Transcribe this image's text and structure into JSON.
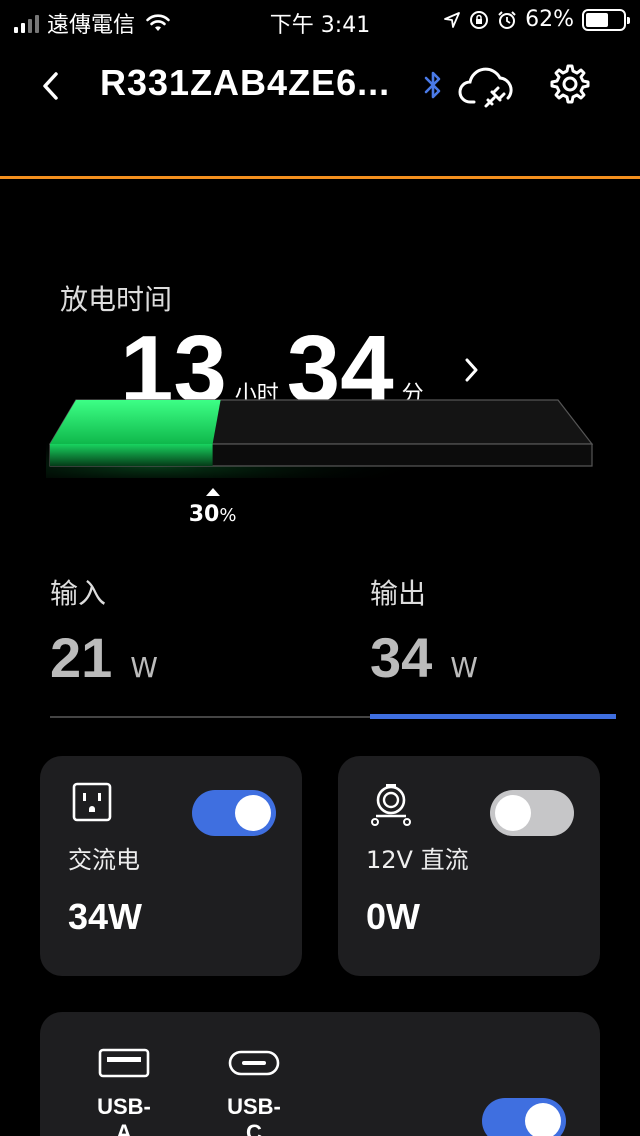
{
  "status_bar": {
    "carrier": "遠傳電信",
    "time": "下午 3:41",
    "battery_percent": "62%",
    "battery_level": 0.62
  },
  "header": {
    "title": "R331ZAB4ZE6...",
    "icons": [
      "back-chevron-icon",
      "bluetooth-icon",
      "cloud-plug-icon",
      "gear-icon"
    ],
    "accent_color": "#f5901e"
  },
  "discharge": {
    "label": "放电时间",
    "hours": "13",
    "hours_unit": "小时",
    "minutes": "34",
    "minutes_unit": "分",
    "percent_value": "30",
    "percent_sign": "%",
    "level": 0.3
  },
  "io": {
    "input_label": "输入",
    "input_value": "21",
    "input_unit": "W",
    "output_label": "输出",
    "output_value": "34",
    "output_unit": "W",
    "active_tab": "output",
    "active_color": "#3f6fe0"
  },
  "outlets": {
    "ac": {
      "name": "交流电",
      "power": "34W",
      "enabled": true,
      "icon": "ac-outlet-icon"
    },
    "dc": {
      "name": "12V 直流",
      "power": "0W",
      "enabled": false,
      "icon": "car-socket-icon"
    },
    "usb": {
      "a_label": "USB-A",
      "c_label": "USB-C",
      "enabled": true
    }
  }
}
